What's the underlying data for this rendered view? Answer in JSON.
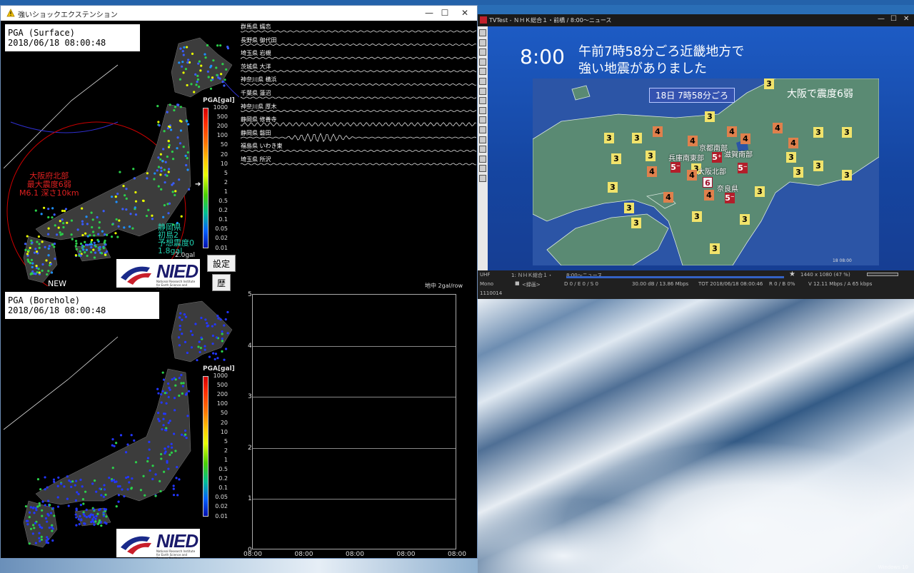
{
  "app": {
    "title": "強いショックエクステンション",
    "surface": {
      "title": "PGA (Surface)",
      "timestamp": "2018/06/18 08:00:48",
      "scale_title": "PGA[gal]",
      "scale_labels": [
        "1000",
        "500",
        "200",
        "100",
        "50",
        "20",
        "10",
        "5",
        "2",
        "1",
        "0.5",
        "0.2",
        "0.1",
        "0.05",
        "0.02",
        "0.01"
      ],
      "epicenter": {
        "line1": "大阪府北部",
        "line2": "最大震度6弱",
        "line3": "M6.1 深さ10km"
      },
      "station": {
        "line1": "静岡県",
        "line2": "初島2",
        "line3": "予想震度0",
        "line4": "1.8gal"
      },
      "gal_small": "2.0gal",
      "new_label": "NEW"
    },
    "borehole": {
      "title": "PGA (Borehole)",
      "timestamp": "2018/06/18 08:00:48",
      "scale_title": "PGA[gal]",
      "scale_labels": [
        "1000",
        "500",
        "200",
        "100",
        "50",
        "20",
        "10",
        "5",
        "2",
        "1",
        "0.5",
        "0.2",
        "0.1",
        "0.05",
        "0.02",
        "0.01"
      ]
    },
    "buttons": {
      "settings": "設定",
      "history": "歴"
    },
    "waveform_stations": [
      "群馬県 嬬恋",
      "長野県 御代田",
      "埼玉県 岩槻",
      "茨城県 大洋",
      "神奈川県 横浜",
      "千葉県 蓮沼",
      "神奈川県 厚木",
      "静岡県 修善寺",
      "静岡県 磐田",
      "福島県 いわき東",
      "埼玉県 所沢"
    ],
    "plot": {
      "header": "地中 2gal/row",
      "y_ticks": [
        "5",
        "4",
        "3",
        "2",
        "1",
        "0"
      ],
      "x_ticks": [
        "08:00",
        "08:00",
        "08:00",
        "08:00",
        "08:00"
      ]
    },
    "nied": {
      "logo": "NIED",
      "sub": "National Research Institute for Earth Science and Disaster Resilience"
    }
  },
  "tv": {
    "title": "TVTest - ＮＨＫ総合１・前橋 / 8:00〜ニュース",
    "clock": "8:00",
    "headline1": "午前7時58分ごろ近畿地方で",
    "headline2": "強い地震がありました",
    "date_box": "18日 7時58分ごろ",
    "big_text": "大阪で震度6弱",
    "places": [
      "京都南部",
      "滋賀南部",
      "兵庫南東部",
      "大阪北部",
      "奈良県"
    ],
    "corner_time": "18 08:00",
    "intensity_icons": [
      {
        "v": "3",
        "c": "ic3"
      },
      {
        "v": "3",
        "c": "ic3"
      },
      {
        "v": "3",
        "c": "ic3"
      },
      {
        "v": "3",
        "c": "ic3"
      },
      {
        "v": "3",
        "c": "ic3"
      },
      {
        "v": "3",
        "c": "ic3"
      },
      {
        "v": "3",
        "c": "ic3"
      },
      {
        "v": "3",
        "c": "ic3"
      },
      {
        "v": "3",
        "c": "ic3"
      },
      {
        "v": "3",
        "c": "ic3"
      },
      {
        "v": "3",
        "c": "ic3"
      },
      {
        "v": "3",
        "c": "ic3"
      },
      {
        "v": "3",
        "c": "ic3"
      },
      {
        "v": "3",
        "c": "ic3"
      },
      {
        "v": "3",
        "c": "ic3"
      },
      {
        "v": "3",
        "c": "ic3"
      },
      {
        "v": "3",
        "c": "ic3"
      },
      {
        "v": "3",
        "c": "ic3"
      },
      {
        "v": "3",
        "c": "ic3"
      },
      {
        "v": "3",
        "c": "ic3"
      },
      {
        "v": "4",
        "c": "ic4"
      },
      {
        "v": "4",
        "c": "ic4"
      },
      {
        "v": "4",
        "c": "ic4"
      },
      {
        "v": "4",
        "c": "ic4"
      },
      {
        "v": "4",
        "c": "ic4"
      },
      {
        "v": "4",
        "c": "ic4"
      },
      {
        "v": "4",
        "c": "ic4"
      },
      {
        "v": "4",
        "c": "ic4"
      },
      {
        "v": "4",
        "c": "ic4"
      },
      {
        "v": "4",
        "c": "ic4"
      },
      {
        "v": "5⁻",
        "c": "ic5"
      },
      {
        "v": "5⁺",
        "c": "ic5"
      },
      {
        "v": "5⁻",
        "c": "ic5"
      },
      {
        "v": "5⁻",
        "c": "ic5"
      },
      {
        "v": "6",
        "c": "ic6"
      }
    ],
    "status": {
      "band": "UHF",
      "channel": "1: ＮＨＫ総合１・",
      "program": "8:00〜ニュース",
      "resolution": "1440 x 1080 (47 %)",
      "audio": "Mono",
      "rec": "<録画>",
      "drops": "D 0 / E 0 / S 0",
      "signal": "30.00 dB / 13.86 Mbps",
      "tot": "TOT 2018/06/18 08:00:46",
      "rb": "R 0 / B 0%",
      "bitrate": "V 12.11 Mbps / A 65 kbps",
      "id": "1110014"
    }
  },
  "desktop": {
    "watermark": "Windows 10"
  }
}
